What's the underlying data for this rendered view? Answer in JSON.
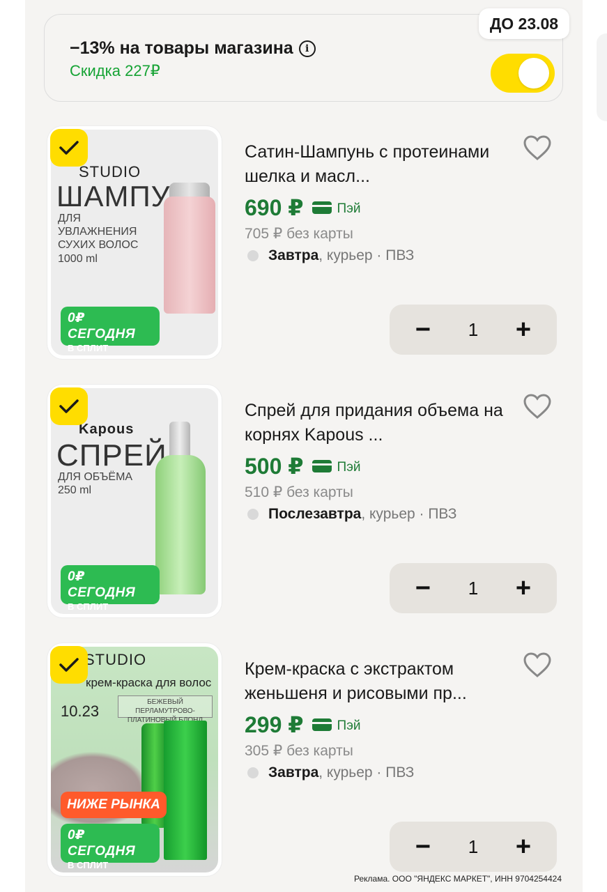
{
  "promo": {
    "title": "−13% на товары магазина",
    "discount": "Скидка 227₽",
    "deadline": "ДО 23.08",
    "toggle_on": true,
    "accent_color": "#ffdd00"
  },
  "products": [
    {
      "title": "Сатин-Шампунь с протеинами шелка и масл...",
      "price": "690 ₽",
      "pay_label": "Пэй",
      "old_price": "705 ₽ без карты",
      "delivery_day": "Завтра",
      "delivery_rest": ", курьер · ПВЗ",
      "quantity": "1",
      "checked": true,
      "image": {
        "brand": "STUDIO",
        "big_word": "ШАМПУНЬ",
        "desc": "ДЛЯ УВЛАЖНЕНИЯ СУХИХ ВОЛОС 1000 ml",
        "badge_top": "0₽ СЕГОДНЯ",
        "badge_bottom": "В СПЛИТ"
      }
    },
    {
      "title": "Спрей для придания объема на корнях Kapous ...",
      "price": "500 ₽",
      "pay_label": "Пэй",
      "old_price": "510 ₽ без карты",
      "delivery_day": "Послезавтра",
      "delivery_rest": ", курьер · ПВЗ",
      "quantity": "1",
      "checked": true,
      "image": {
        "brand": "Kapous",
        "big_word": "СПРЕЙ",
        "desc": "ДЛЯ ОБЪЁМА 250 ml",
        "badge_top": "0₽ СЕГОДНЯ",
        "badge_bottom": "В СПЛИТ"
      }
    },
    {
      "title": "Крем-краска с экстрактом женьшеня и рисовыми пр...",
      "price": "299 ₽",
      "pay_label": "Пэй",
      "old_price": "305 ₽ без карты",
      "delivery_day": "Завтра",
      "delivery_rest": ", курьер · ПВЗ",
      "quantity": "1",
      "checked": true,
      "image": {
        "brand": "STUDIO",
        "subtitle": "крем-краска для волос",
        "shade_number": "10.23",
        "shade_name": "БЕЖЕВЫЙ ПЕРЛАМУТРОВО-ПЛАТИНОВЫЙ БЛОНД",
        "market_badge": "НИЖЕ РЫНКА",
        "badge_top": "0₽ СЕГОДНЯ",
        "badge_bottom": "В СПЛИТ"
      }
    }
  ],
  "stepper": {
    "minus": "−",
    "plus": "+"
  },
  "legal": "Реклама. ООО \"ЯНДЕКС МАРКЕТ\", ИНН 9704254424",
  "colors": {
    "price_green": "#1e7b36",
    "discount_green": "#15a334",
    "split_green": "#2dbb52",
    "market_orange": "#ff5a2b"
  }
}
